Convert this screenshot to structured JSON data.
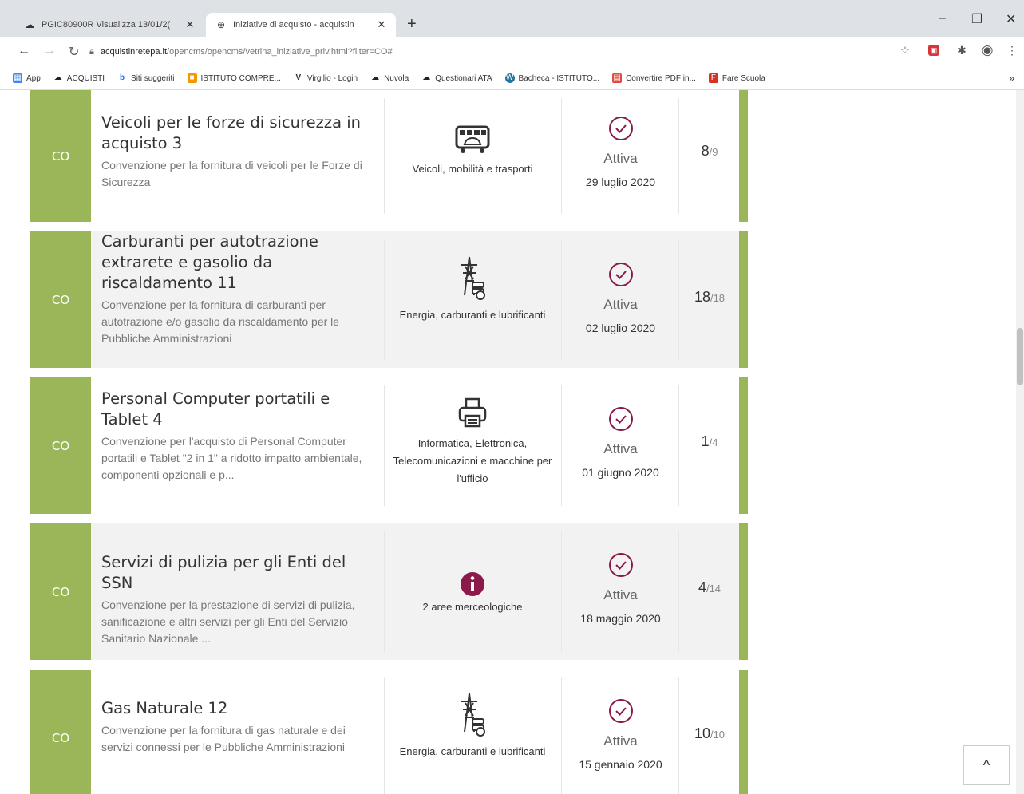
{
  "browser": {
    "tabs": [
      {
        "title": "PGIC80900R Visualizza 13/01/2(",
        "active": false
      },
      {
        "title": "Iniziative di acquisto - acquistin",
        "active": true
      }
    ],
    "new_tab": "+",
    "window_controls": {
      "minimize": "–",
      "maximize": "❐",
      "close": "✕"
    },
    "url_host": "acquistinretepa.it",
    "url_path": "/opencms/opencms/vetrina_iniziative_priv.html?filter=CO#",
    "bookmarks": [
      {
        "label": "App",
        "color": "#4285f4"
      },
      {
        "label": "ACQUISTI",
        "color": "#222222"
      },
      {
        "label": "Siti suggeriti",
        "color": "#1a73e8"
      },
      {
        "label": "ISTITUTO COMPRE...",
        "color": "#f29900"
      },
      {
        "label": "Virgilio - Login",
        "color": "#333333"
      },
      {
        "label": "Nuvola",
        "color": "#222222"
      },
      {
        "label": "Questionari ATA",
        "color": "#222222"
      },
      {
        "label": "Bacheca - ISTITUTO...",
        "color": "#21759b"
      },
      {
        "label": "Convertire PDF in...",
        "color": "#e04a3f"
      },
      {
        "label": "Fare Scuola",
        "color": "#d93025"
      }
    ],
    "more_bookmarks": "»"
  },
  "rows": [
    {
      "badge": "CO",
      "title": "Veicoli per le forze di sicurezza in acquisto 3",
      "description": "Convenzione per la fornitura di veicoli per le Forze di Sicurezza",
      "category_icon": "bus-icon",
      "category": "Veicoli, mobilità e trasporti",
      "status": "Attiva",
      "date": "29 luglio 2020",
      "count": "8",
      "total": "/9"
    },
    {
      "badge": "CO",
      "title": "Carburanti per autotrazione extrarete e gasolio da riscaldamento 11",
      "description": "Convenzione per la fornitura di carburanti per autotrazione e/o gasolio da riscaldamento per le Pubbliche Amministrazioni",
      "category_icon": "power-tower-icon",
      "category": "Energia, carburanti e lubrificanti",
      "status": "Attiva",
      "date": "02 luglio 2020",
      "count": "18",
      "total": "/18"
    },
    {
      "badge": "CO",
      "title": "Personal Computer portatili e Tablet 4",
      "description": "Convenzione per l'acquisto di Personal Computer portatili e Tablet \"2 in 1\" a ridotto impatto ambientale, componenti opzionali e p...",
      "category_icon": "printer-icon",
      "category": "Informatica, Elettronica, Telecomunicazioni e macchine per l'ufficio",
      "status": "Attiva",
      "date": "01 giugno 2020",
      "count": "1",
      "total": "/4"
    },
    {
      "badge": "CO",
      "title": "Servizi di pulizia per gli Enti del SSN",
      "description": "Convenzione per la prestazione di servizi di pulizia, sanificazione e altri servizi per gli Enti del Servizio Sanitario Nazionale ...",
      "category_icon": "info-icon",
      "category": "2 aree merceologiche",
      "status": "Attiva",
      "date": "18 maggio 2020",
      "count": "4",
      "total": "/14"
    },
    {
      "badge": "CO",
      "title": "Gas Naturale 12",
      "description": "Convenzione per la fornitura di gas naturale e dei servizi connessi per le Pubbliche Amministrazioni",
      "category_icon": "power-tower-icon",
      "category": "Energia, carburanti e lubrificanti",
      "status": "Attiva",
      "date": "15 gennaio 2020",
      "count": "10",
      "total": "/10"
    }
  ],
  "back_to_top": "^",
  "colors": {
    "accent_green": "#9bb559",
    "info_purple": "#8b1a4a",
    "check_purple": "#8b1a4a"
  }
}
